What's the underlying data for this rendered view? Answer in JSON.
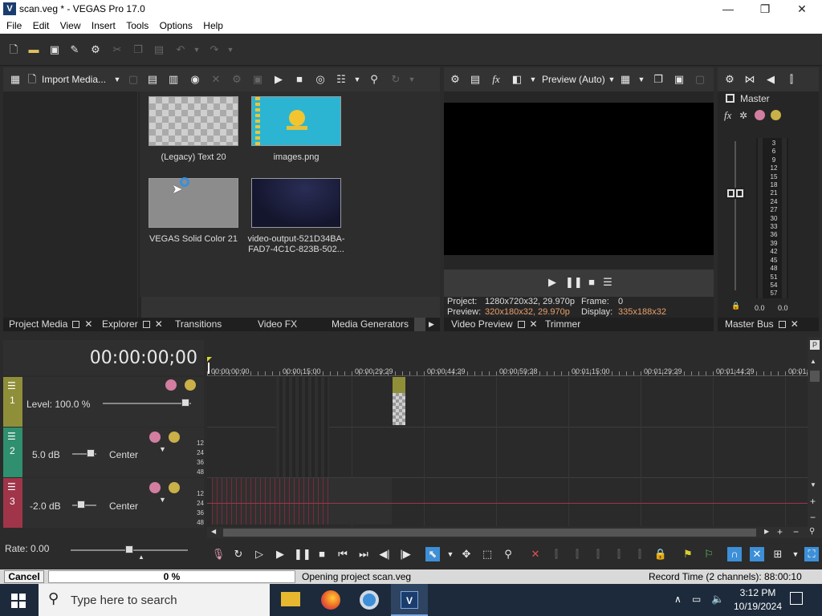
{
  "window": {
    "title": "scan.veg * - VEGAS Pro 17.0",
    "app_icon": "V",
    "minimize": "—",
    "maximize": "❐",
    "close": "✕"
  },
  "menu": [
    "File",
    "Edit",
    "View",
    "Insert",
    "Tools",
    "Options",
    "Help"
  ],
  "media": {
    "import_label": "Import Media...",
    "items": [
      {
        "caption": "(Legacy) Text 20"
      },
      {
        "caption": "images.png"
      },
      {
        "caption": "VEGAS Solid Color 21"
      },
      {
        "caption_line1": "video-output-521D34BA-",
        "caption_line2": "FAD7-4C1C-823B-502..."
      }
    ],
    "tabs": [
      "Project Media",
      "Explorer",
      "Transitions",
      "Video FX",
      "Media Generators"
    ]
  },
  "preview": {
    "mode_label": "Preview (Auto)",
    "project_label": "Project:",
    "project_value": "1280x720x32, 29.970p",
    "frame_label": "Frame:",
    "frame_value": "0",
    "preview_label": "Preview:",
    "preview_value": "320x180x32, 29.970p",
    "display_label": "Display:",
    "display_value": "335x188x32",
    "tabs": [
      "Video Preview",
      "Trimmer"
    ]
  },
  "master": {
    "label": "Master",
    "meter_scale": [
      "3",
      "6",
      "9",
      "12",
      "15",
      "18",
      "21",
      "24",
      "27",
      "30",
      "33",
      "36",
      "39",
      "42",
      "45",
      "48",
      "51",
      "54",
      "57"
    ],
    "left_value": "0.0",
    "right_value": "0.0",
    "tab": "Master Bus"
  },
  "timeline": {
    "timecode": "00:00:00;00",
    "ruler": [
      "00:00:00;00",
      "00:00:15;00",
      "00:00:29;29",
      "00:00:44;29",
      "00:00:59;28",
      "00:01:15;00",
      "00:01:29;29",
      "00:01:44;29",
      "00:01:5"
    ],
    "tracks": [
      {
        "num": "1",
        "level": "Level: 100.0 %"
      },
      {
        "num": "2",
        "level": "5.0 dB",
        "pan": "Center",
        "scale": [
          "12",
          "24",
          "36",
          "48"
        ]
      },
      {
        "num": "3",
        "level": "-2.0 dB",
        "pan": "Center",
        "scale": [
          "12",
          "24",
          "36",
          "48"
        ]
      }
    ],
    "rate": "Rate: 0.00"
  },
  "status": {
    "cancel": "Cancel",
    "progress": "0 %",
    "progress_value": 0,
    "message": "Opening project scan.veg",
    "record_time": "Record Time (2 channels): 88:00:10"
  },
  "taskbar": {
    "search_placeholder": "Type here to search",
    "time": "3:12 PM",
    "date": "10/19/2024"
  },
  "colors": {
    "track1": "#8f8f3a",
    "track2": "#2f8f6f",
    "track3": "#a0354a",
    "accent_orange": "#e8a06a",
    "select_blue": "#3d8fd8"
  }
}
